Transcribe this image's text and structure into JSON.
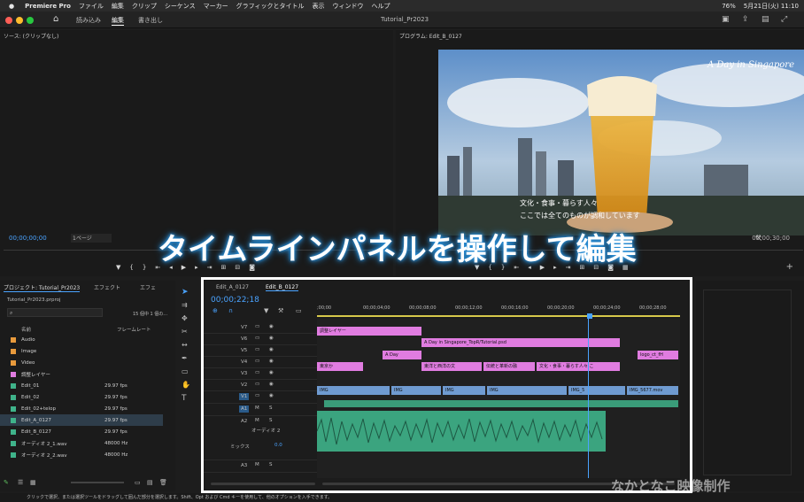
{
  "menubar": {
    "app": "Premiere Pro",
    "items": [
      "ファイル",
      "編集",
      "クリップ",
      "シーケンス",
      "マーカー",
      "グラフィックとタイトル",
      "表示",
      "ウィンドウ",
      "ヘルプ"
    ],
    "battery": "76%",
    "datetime": "5月21日(火) 11:10"
  },
  "workspace": {
    "tabs": [
      "読み込み",
      "編集",
      "書き出し"
    ],
    "active": "編集",
    "project_title": "Tutorial_Pr2023"
  },
  "source": {
    "title": "ソース: (クリップなし)",
    "timecode": "00;00;00;00",
    "zoom": "1ページ"
  },
  "program": {
    "title": "プログラム: Edit_B_0127",
    "end_timecode": "00;00;30;00",
    "overlay_title": "A Day in Singapore",
    "subtitle1": "文化・食事・暮らす人々",
    "subtitle2": "ここでは全てのものが調和しています"
  },
  "banner": "タイムラインパネルを操作して編集",
  "project": {
    "tab1": "プロジェクト: Tutorial_Pr2023",
    "tab2": "エフェクト",
    "tab3": "エフェ",
    "file": "Tutorial_Pr2023.prproj",
    "count": "15 個中 1 個の...",
    "col_name": "名前",
    "col_rate": "フレームレート",
    "items": [
      {
        "name": "Audio",
        "rate": "",
        "color": "#e89a3c"
      },
      {
        "name": "Image",
        "rate": "",
        "color": "#e89a3c"
      },
      {
        "name": "Video",
        "rate": "",
        "color": "#e89a3c"
      },
      {
        "name": "調整レイヤー",
        "rate": "",
        "color": "#e07ce0"
      },
      {
        "name": "Edit_01",
        "rate": "29.97 fps",
        "color": "#3fb38a"
      },
      {
        "name": "Edit_02",
        "rate": "29.97 fps",
        "color": "#3fb38a"
      },
      {
        "name": "Edit_02+telop",
        "rate": "29.97 fps",
        "color": "#3fb38a"
      },
      {
        "name": "Edit_A_0127",
        "rate": "29.97 fps",
        "color": "#3fb38a"
      },
      {
        "name": "Edit_B_0127",
        "rate": "29.97 fps",
        "color": "#3fb38a"
      },
      {
        "name": "オーディオ 2_1.wav",
        "rate": "48000 Hz",
        "color": "#3fb38a"
      },
      {
        "name": "オーディオ 2_2.wav",
        "rate": "48000 Hz",
        "color": "#3fb38a"
      }
    ]
  },
  "timeline": {
    "tab1": "Edit_A_0127",
    "tab2": "Edit_B_0127",
    "timecode": "00;00;22;18",
    "ruler": [
      ";00;00",
      "00;00;04;00",
      "00;00;08;00",
      "00;00;12;00",
      "00;00;16;00",
      "00;00;20;00",
      "00;00;24;00",
      "00;00;28;00"
    ],
    "tracks": [
      "V7",
      "V6",
      "V5",
      "V4",
      "V3",
      "V2",
      "V1",
      "A1",
      "A2",
      "A3"
    ],
    "audio_label": "オーディオ 2",
    "mix_label": "ミックス",
    "mix_value": "0.0",
    "clips": {
      "adj": "調整レイヤー",
      "psd": "A Day in Singapore_TopR/Tutorial.psd",
      "aday": "A Day",
      "logo": "logo_ct_fH",
      "tokyo": "東京か",
      "east_west": "東洋と西洋の文",
      "tradition": "伝統と革新の融",
      "culture": "文化・食事・暮らす人々 こ",
      "img": "IMG",
      "img5": "IMG_5",
      "img_mov": "IMG_5677.mov"
    }
  },
  "status": "クリックで選択、または選択ツールをドラッグして囲んだ部分を選択します。Shift、Opt および Cmd キーを使用して、他のオプションを入手できます。",
  "watermark": "なかとなこ映像制作"
}
